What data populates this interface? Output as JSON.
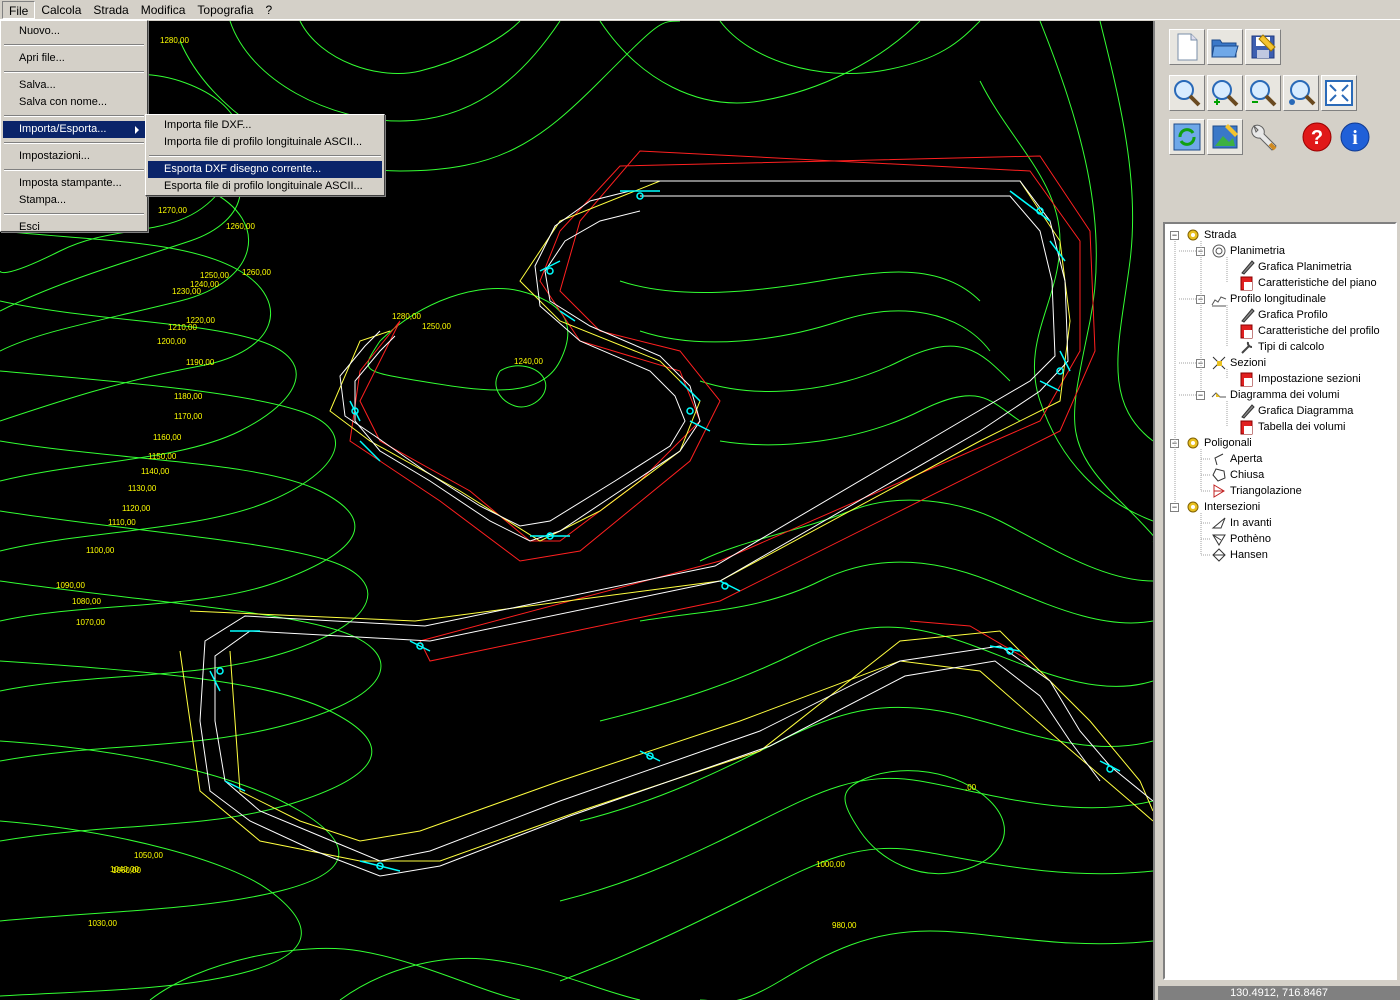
{
  "menubar": {
    "items": [
      "File",
      "Calcola",
      "Strada",
      "Modifica",
      "Topografia",
      "?"
    ]
  },
  "file_menu": {
    "items": [
      "Nuovo...",
      "Apri file...",
      "Salva...",
      "Salva con nome...",
      "Importa/Esporta...",
      "Impostazioni...",
      "Imposta stampante...",
      "Stampa...",
      "Esci"
    ]
  },
  "submenu": {
    "items": [
      "Importa file DXF...",
      "Importa file di profilo longituinale ASCII...",
      "Esporta DXF disegno corrente...",
      "Esporta file di profilo longituinale ASCII..."
    ]
  },
  "toolbar": {
    "icons": [
      "new-file-icon",
      "open-folder-icon",
      "save-disk-icon",
      "zoom-icon",
      "zoom-in-icon",
      "zoom-out-icon",
      "zoom-window-icon",
      "zoom-extents-icon",
      "refresh-icon",
      "image-icon",
      "wrench-icon",
      "help-icon",
      "info-icon"
    ]
  },
  "tree": {
    "strada": "Strada",
    "planimetria": "Planimetria",
    "grafica_planimetria": "Grafica Planimetria",
    "caratteristiche_piano": "Caratteristiche del piano",
    "profilo": "Profilo longitudinale",
    "grafica_profilo": "Grafica Profilo",
    "caratteristiche_profilo": "Caratteristiche del profilo",
    "tipi_calcolo": "Tipi di calcolo",
    "sezioni": "Sezioni",
    "impostazione_sezioni": "Impostazione sezioni",
    "diagramma": "Diagramma dei volumi",
    "grafica_diagramma": "Grafica Diagramma",
    "tabella_volumi": "Tabella dei volumi",
    "poligonali": "Poligonali",
    "aperta": "Aperta",
    "chiusa": "Chiusa",
    "triangolazione": "Triangolazione",
    "intersezioni": "Intersezioni",
    "in_avanti": "In avanti",
    "pothenot": "Pothèno",
    "hansen": "Hansen"
  },
  "status": {
    "coords": "130.4912,  716.8467"
  },
  "map": {
    "contour_color": "#33ff33",
    "label_color": "#ffff00",
    "road_color": "#ffffff",
    "station_color": "#00ffff",
    "border_red": "#ff2020",
    "border_yellow": "#ffff40",
    "elevation_labels": [
      "1280,00",
      "1270,00",
      "1260,00",
      "1250,00",
      "1240,00",
      "1230,00",
      "1220,00",
      "1210,00",
      "1200,00",
      "1190,00",
      "1180,00",
      "1170,00",
      "1160,00",
      "1150,00",
      "1140,00",
      "1130,00",
      "1120,00",
      "1110,00",
      "1100,00",
      "1090,00",
      "1080,00",
      "1070,00",
      "1060,00",
      "1050,00",
      "1040,00",
      "1030,00",
      "1000,00",
      "980,00",
      ",00",
      "1280,00",
      "1260,00",
      "1250,00",
      "1240,00"
    ]
  }
}
